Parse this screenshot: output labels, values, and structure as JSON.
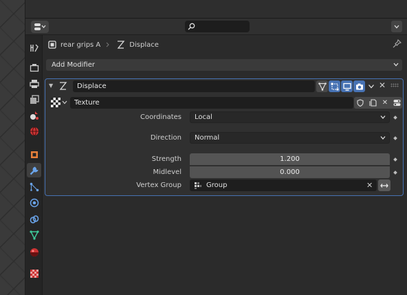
{
  "search": {
    "placeholder": ""
  },
  "breadcrumb": {
    "object": "rear grips A",
    "modifier": "Displace"
  },
  "add_modifier": {
    "label": "Add Modifier"
  },
  "modifier": {
    "name": "Displace",
    "texture": "Texture",
    "coordinates": {
      "label": "Coordinates",
      "value": "Local"
    },
    "direction": {
      "label": "Direction",
      "value": "Normal"
    },
    "strength": {
      "label": "Strength",
      "value": "1.200"
    },
    "midlevel": {
      "label": "Midlevel",
      "value": "0.000"
    },
    "vertex_group": {
      "label": "Vertex Group",
      "value": "Group"
    }
  },
  "colors": {
    "accent": "#4772b3",
    "panel": "#303030",
    "background": "#2b2b2b"
  },
  "tabs": [
    "tool-icon",
    "render-icon",
    "output-icon",
    "view-layer-icon",
    "scene-icon",
    "world-icon",
    "object-icon",
    "modifier-icon",
    "particles-icon",
    "physics-icon",
    "constraints-icon",
    "data-icon",
    "material-icon",
    "texture-icon"
  ]
}
